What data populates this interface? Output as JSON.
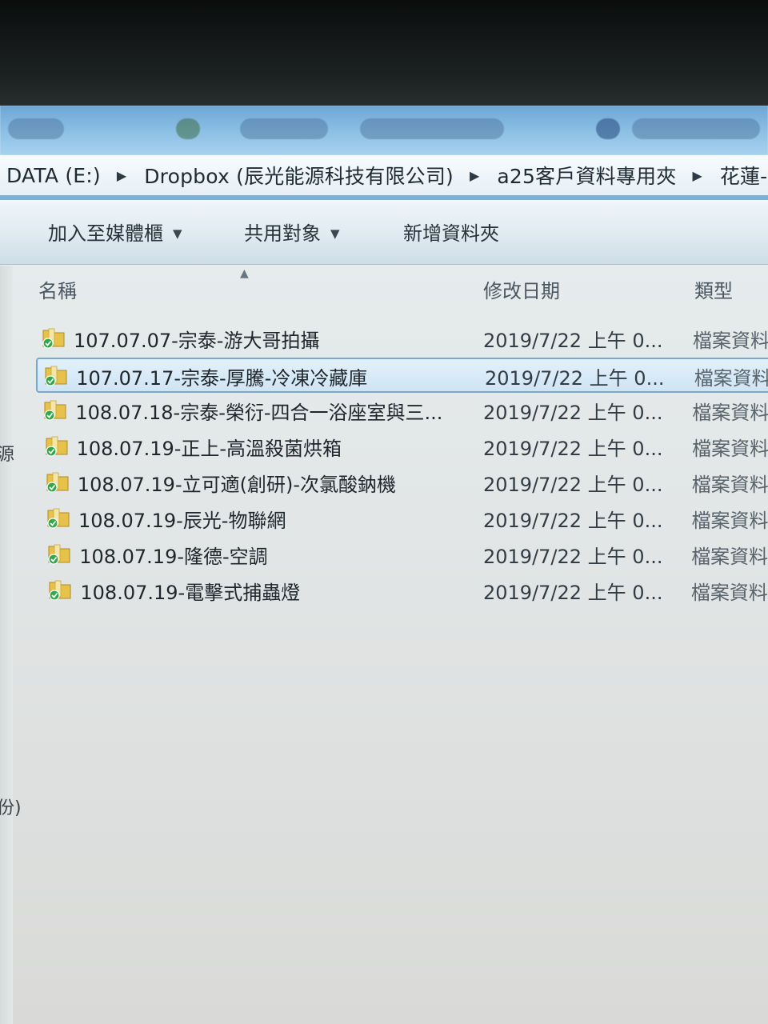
{
  "address_bar": {
    "crumbs": [
      "DATA (E:)",
      "Dropbox (辰光能源科技有限公司)",
      "a25客戶資料專用夾",
      "花蓮-"
    ]
  },
  "toolbar": {
    "add_to_library": "加入至媒體櫃",
    "share_with": "共用對象",
    "new_folder": "新增資料夾"
  },
  "columns": {
    "name": "名稱",
    "date_modified": "修改日期",
    "type": "類型"
  },
  "left_fragments": [
    "源",
    "份)"
  ],
  "files": [
    {
      "name": "107.07.07-宗泰-游大哥拍攝",
      "date": "2019/7/22 上午 0...",
      "type": "檔案資料",
      "selected": false
    },
    {
      "name": "107.07.17-宗泰-厚騰-冷凍冷藏庫",
      "date": "2019/7/22 上午 0...",
      "type": "檔案資料",
      "selected": true
    },
    {
      "name": "108.07.18-宗泰-榮衍-四合一浴座室與三...",
      "date": "2019/7/22 上午 0...",
      "type": "檔案資料",
      "selected": false
    },
    {
      "name": "108.07.19-正上-高溫殺菌烘箱",
      "date": "2019/7/22 上午 0...",
      "type": "檔案資料",
      "selected": false
    },
    {
      "name": "108.07.19-立可適(創研)-次氯酸鈉機",
      "date": "2019/7/22 上午 0...",
      "type": "檔案資料",
      "selected": false
    },
    {
      "name": "108.07.19-辰光-物聯網",
      "date": "2019/7/22 上午 0...",
      "type": "檔案資料",
      "selected": false
    },
    {
      "name": "108.07.19-隆德-空調",
      "date": "2019/7/22 上午 0...",
      "type": "檔案資料",
      "selected": false
    },
    {
      "name": "108.07.19-電擊式捕蟲燈",
      "date": "2019/7/22 上午 0...",
      "type": "檔案資料",
      "selected": false
    }
  ],
  "colors": {
    "selection_border": "#7aa7cc",
    "folder_yellow": "#e7c24a",
    "sync_green": "#2fa84a"
  },
  "icons": {
    "folder": "dropbox-synced-folder-icon",
    "separator": "breadcrumb-chevron-right-icon",
    "dropdown": "chevron-down-icon",
    "sort": "sort-ascending-icon"
  }
}
